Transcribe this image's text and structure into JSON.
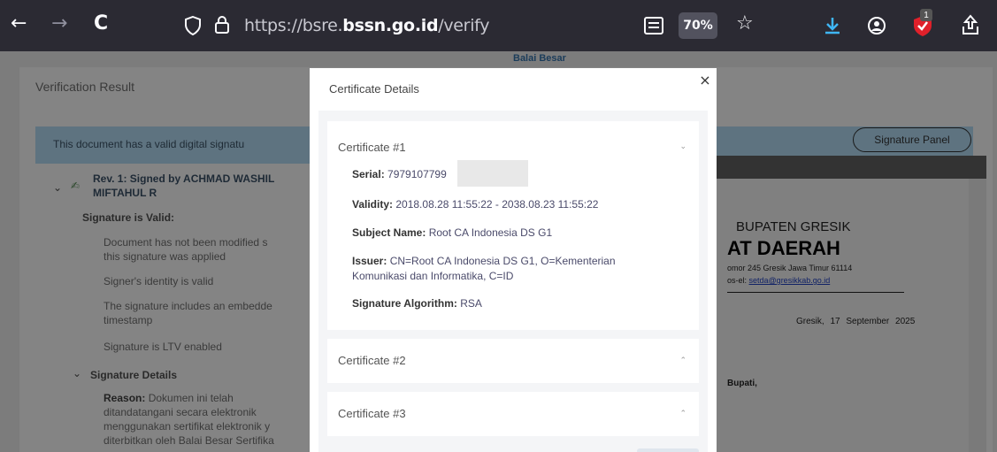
{
  "browser": {
    "back": "←",
    "forward": "→",
    "reload": "C",
    "url_prefix": "https://bsre.",
    "url_domain": "bssn.go.id",
    "url_path": "/verify",
    "zoom": "70%",
    "ext_badge": "1"
  },
  "page": {
    "logo_text": "Balai Besar",
    "verification_title": "Verification Result",
    "valid_banner": "This document has a valid digital signatu",
    "signature_panel_button": "Signature Panel",
    "left_items": {
      "rev": "Rev. 1: Signed by ACHMAD WASHIL",
      "rev2": "MIFTAHUL R",
      "sig_valid": "Signature is Valid:",
      "l1": "Document has not been modified s",
      "l2": "this signature was applied",
      "l3": "Signer's identity is valid",
      "l4": "The signature includes an embedde",
      "l5": "timestamp",
      "l6": "Signature is LTV enabled",
      "details": "Signature Details",
      "reason_label": "Reason:",
      "r1": "Dokumen ini telah",
      "r2": "ditandatangani secara elektronik",
      "r3": "menggunakan sertifikat elektronik y",
      "r4": "diterbitkan oleh Balai Besar Sertifika"
    },
    "document": {
      "line1": "BUPATEN GRESIK",
      "line2": "AT DAERAH",
      "line3": "omor 245 Gresik Jawa Timur 61114",
      "line4_prefix": "os-el:",
      "line4_email": "setda@gresikkab.go.id",
      "line5": "Gresik, 17 September 2025",
      "line6": "Bupati,"
    }
  },
  "modal": {
    "title": "Certificate Details",
    "close": "×",
    "certificates": [
      {
        "title": "Certificate #1",
        "serial_label": "Serial:",
        "serial_value": "7979107799",
        "validity_label": "Validity:",
        "validity_value": "2018.08.28 11:55:22 - 2038.08.23 11:55:22",
        "subject_label": "Subject Name:",
        "subject_value": "Root CA Indonesia DS G1",
        "issuer_label": "Issuer:",
        "issuer_value_1": "CN=Root CA Indonesia DS G1, O=Kementerian",
        "issuer_value_2": "Komunikasi dan Informatika, C=ID",
        "algo_label": "Signature Algorithm:",
        "algo_value": "RSA"
      },
      {
        "title": "Certificate #2"
      },
      {
        "title": "Certificate #3"
      }
    ]
  }
}
